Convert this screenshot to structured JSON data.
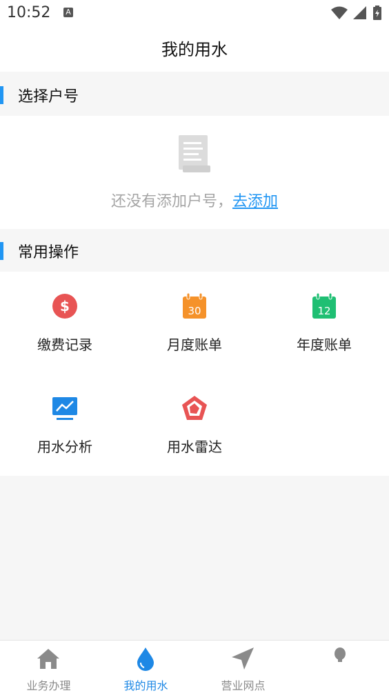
{
  "status": {
    "time": "10:52",
    "a_badge": "A"
  },
  "appbar": {
    "title": "我的用水"
  },
  "account_section": {
    "title": "选择户号"
  },
  "empty": {
    "text": "还没有添加户号，",
    "link": "去添加"
  },
  "ops_section": {
    "title": "常用操作"
  },
  "ops": [
    {
      "label": "缴费记录",
      "icon": "dollar-circle-icon",
      "color": "#e85454"
    },
    {
      "label": "月度账单",
      "icon": "calendar-30-icon",
      "color": "#f5922a",
      "icon_text": "30"
    },
    {
      "label": "年度账单",
      "icon": "calendar-12-icon",
      "color": "#1fbf73",
      "icon_text": "12"
    },
    {
      "label": "用水分析",
      "icon": "chart-monitor-icon",
      "color": "#1e88e5"
    },
    {
      "label": "用水雷达",
      "icon": "radar-pentagon-icon",
      "color": "#e85454"
    }
  ],
  "tabs": [
    {
      "label": "业务办理",
      "icon": "home-icon"
    },
    {
      "label": "我的用水",
      "icon": "water-drop-icon",
      "active": true
    },
    {
      "label": "营业网点",
      "icon": "navigation-arrow-icon"
    },
    {
      "label": "",
      "icon": "bulb-icon"
    }
  ],
  "colors": {
    "accent": "#2196f3",
    "tab_active": "#1e88e5",
    "tab_inactive": "#8a8a8a"
  }
}
